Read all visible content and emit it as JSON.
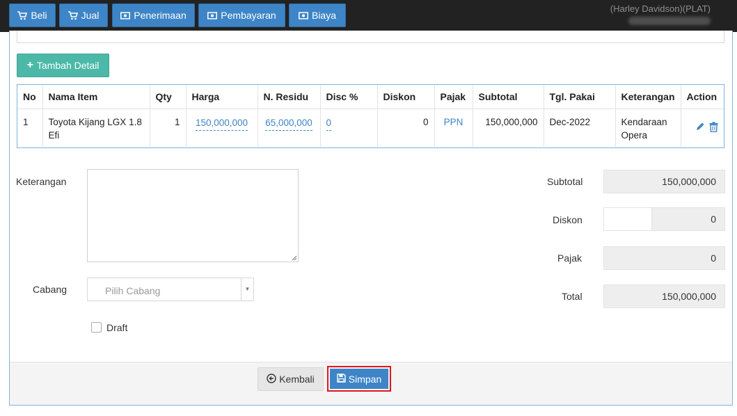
{
  "nav": {
    "beli": "Beli",
    "jual": "Jual",
    "penerimaan": "Penerimaan",
    "pembayaran": "Pembayaran",
    "biaya": "Biaya",
    "user_label": "(Harley Davidson)(PLAT)"
  },
  "detail": {
    "add_label": "Tambah Detail",
    "headers": [
      "No",
      "Nama Item",
      "Qty",
      "Harga",
      "N. Residu",
      "Disc %",
      "Diskon",
      "Pajak",
      "Subtotal",
      "Tgl. Pakai",
      "Keterangan",
      "Action"
    ],
    "rows": [
      {
        "no": "1",
        "item": "Toyota Kijang LGX 1.8 Efi",
        "qty": "1",
        "harga": "150,000,000",
        "residu": "65,000,000",
        "disc_pct": "0",
        "diskon": "0",
        "pajak": "PPN",
        "subtotal": "150,000,000",
        "tgl_pakai": "Dec-2022",
        "keterangan": "Kendaraan Opera"
      }
    ]
  },
  "form": {
    "keterangan_label": "Keterangan",
    "cabang_label": "Cabang",
    "cabang_placeholder": "Pilih Cabang",
    "draft_label": "Draft"
  },
  "summary": {
    "subtotal_label": "Subtotal",
    "subtotal_value": "150,000,000",
    "diskon_label": "Diskon",
    "diskon_value": "0",
    "pajak_label": "Pajak",
    "pajak_value": "0",
    "total_label": "Total",
    "total_value": "150,000,000"
  },
  "footer": {
    "back_label": "Kembali",
    "save_label": "Simpan"
  },
  "colors": {
    "primary": "#3d85c6",
    "teal": "#4cb8a8",
    "highlight": "#e0161c",
    "topbar": "#222222"
  }
}
